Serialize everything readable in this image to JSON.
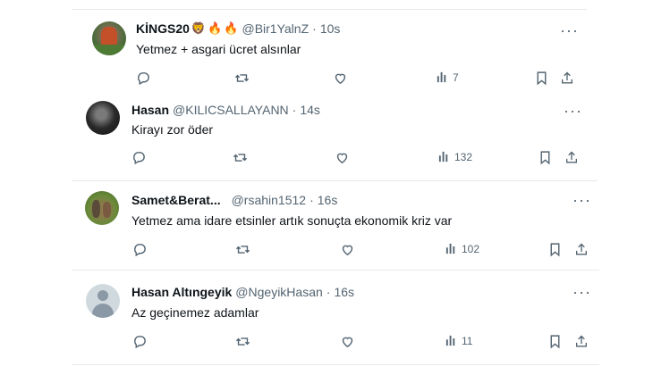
{
  "tweets": [
    {
      "name": "KİNGS20",
      "emoji": [
        "🦁",
        "🔥",
        "🔥"
      ],
      "handle": "@Bir1YalnZ",
      "dot": "·",
      "time": "10s",
      "text": "Yetmez + asgari ücret alsınlar",
      "views": "7"
    },
    {
      "name": "Hasan",
      "handle": "@KILICSALLAYANN",
      "dot": "·",
      "time": "14s",
      "text": "Kirayı zor öder",
      "views": "132"
    },
    {
      "name": "Samet&Berat...",
      "handle": "@rsahin1512",
      "dot": "·",
      "time": "16s",
      "text": "Yetmez ama idare etsinler artık sonuçta ekonomik kriz var",
      "views": "102"
    },
    {
      "name": "Hasan Altıngeyik",
      "handle": "@NgeyikHasan",
      "dot": "·",
      "time": "16s",
      "text": "Az geçinemez adamlar",
      "views": "11"
    }
  ],
  "more_label": "···",
  "icons": [
    "reply-icon",
    "retweet-icon",
    "like-icon",
    "views-icon",
    "bookmark-icon",
    "share-icon"
  ],
  "colors": {
    "text": "#0f1419",
    "secondary": "#536471",
    "divider": "#e6e9ec"
  }
}
